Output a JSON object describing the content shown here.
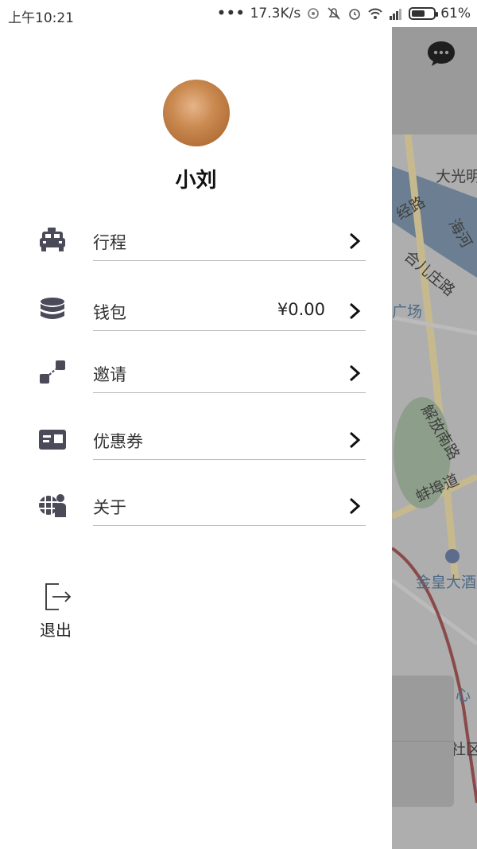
{
  "status_bar": {
    "time": "上午10:21",
    "network_speed": "17.3K/s",
    "battery_percent": "61%",
    "battery_level": 0.61
  },
  "drawer": {
    "avatar": "avatar-photo",
    "username": "小刘",
    "menu": [
      {
        "label": "行程",
        "icon": "taxi-icon",
        "value": ""
      },
      {
        "label": "钱包",
        "icon": "wallet-coins-icon",
        "value": "¥0.00"
      },
      {
        "label": "邀请",
        "icon": "invite-share-icon",
        "value": ""
      },
      {
        "label": "优惠券",
        "icon": "coupon-card-icon",
        "value": ""
      },
      {
        "label": "关于",
        "icon": "about-icon",
        "value": ""
      }
    ],
    "logout": {
      "label": "退出",
      "icon": "logout-icon"
    }
  },
  "background_map": {
    "chat_icon": "chat-bubble-icon",
    "labels": [
      "大光明",
      "经路",
      "海河",
      "合儿庄路",
      "广场",
      "解放南路",
      "蚌埠道",
      "金皇大酒",
      "心",
      "社区"
    ]
  }
}
